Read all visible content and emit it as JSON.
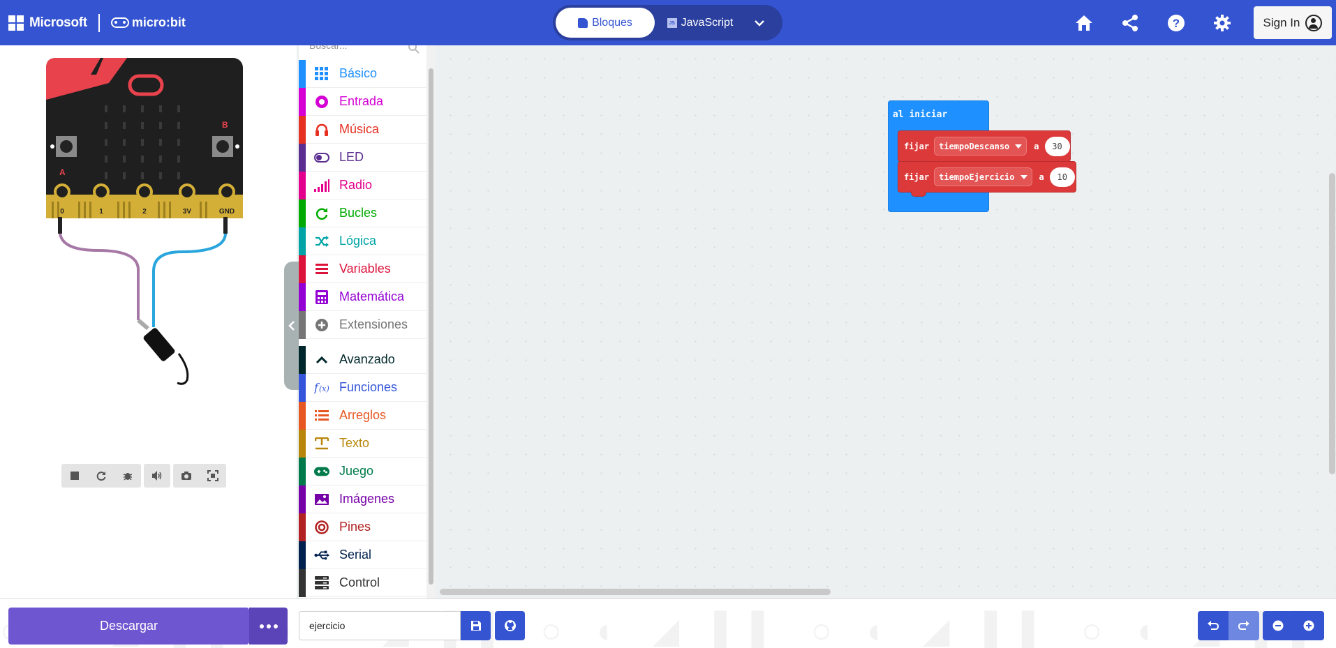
{
  "header": {
    "brand": "Microsoft",
    "product": "micro:bit",
    "modes": {
      "blocks": "Bloques",
      "javascript": "JavaScript",
      "js_badge": "JS"
    },
    "signin": "Sign In"
  },
  "simulator": {
    "pins": [
      "0",
      "1",
      "2",
      "3V",
      "GND"
    ],
    "button_a": "A",
    "button_b": "B"
  },
  "toolbox": {
    "search_placeholder": "Buscar...",
    "categories": [
      {
        "label": "Básico",
        "color": "#1e90ff",
        "icon": "grid-icon"
      },
      {
        "label": "Entrada",
        "color": "#d400d4",
        "icon": "target-icon"
      },
      {
        "label": "Música",
        "color": "#e63022",
        "icon": "headphones-icon"
      },
      {
        "label": "LED",
        "color": "#5c2d91",
        "icon": "toggle-icon"
      },
      {
        "label": "Radio",
        "color": "#e3008c",
        "icon": "signal-icon"
      },
      {
        "label": "Bucles",
        "color": "#00aa00",
        "icon": "refresh-icon"
      },
      {
        "label": "Lógica",
        "color": "#00a4a6",
        "icon": "shuffle-icon"
      },
      {
        "label": "Variables",
        "color": "#dc143c",
        "icon": "list-icon"
      },
      {
        "label": "Matemática",
        "color": "#9400d3",
        "icon": "calculator-icon"
      },
      {
        "label": "Extensiones",
        "color": "#757575",
        "icon": "plus-circle-icon"
      }
    ],
    "advanced": [
      {
        "label": "Avanzado",
        "color": "#00272b",
        "icon": "chevron-up-icon"
      },
      {
        "label": "Funciones",
        "color": "#3455db",
        "icon": "function-icon"
      },
      {
        "label": "Arreglos",
        "color": "#e65722",
        "icon": "array-list-icon"
      },
      {
        "label": "Texto",
        "color": "#b8860b",
        "icon": "text-icon"
      },
      {
        "label": "Juego",
        "color": "#007a4b",
        "icon": "gamepad-icon"
      },
      {
        "label": "Imágenes",
        "color": "#7600a8",
        "icon": "image-icon"
      },
      {
        "label": "Pines",
        "color": "#b22222",
        "icon": "bullseye-icon"
      },
      {
        "label": "Serial",
        "color": "#002050",
        "icon": "usb-icon"
      },
      {
        "label": "Control",
        "color": "#333333",
        "icon": "server-icon"
      }
    ]
  },
  "workspace": {
    "on_start": "al iniciar",
    "set_blocks": [
      {
        "keyword": "fijar",
        "variable": "tiempoDescanso",
        "to": "a",
        "value": "30"
      },
      {
        "keyword": "fijar",
        "variable": "tiempoEjercicio",
        "to": "a",
        "value": "10"
      }
    ]
  },
  "footer": {
    "download": "Descargar",
    "project_name": "ejercicio"
  }
}
